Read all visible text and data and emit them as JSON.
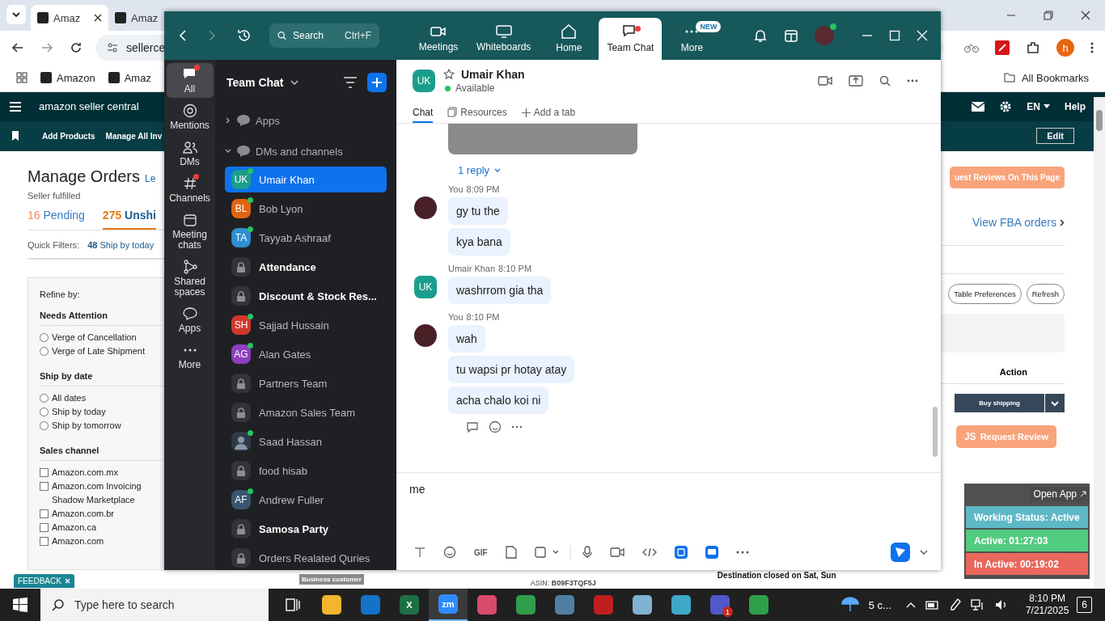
{
  "browser": {
    "tabs": [
      {
        "title": "Amaz",
        "selected": true
      },
      {
        "title": "Amaz",
        "selected": false
      }
    ],
    "address": "sellerce",
    "bookmarks": [
      "Amazon",
      "Amaz"
    ],
    "all_bookmarks": "All Bookmarks",
    "profile_initial": "h"
  },
  "seller": {
    "logo": "amazon seller central",
    "language": "EN",
    "help": "Help",
    "nav": [
      "Add Products",
      "Manage All Inv"
    ],
    "edit": "Edit",
    "title": "Manage Orders",
    "title_link": "Le",
    "subtitle": "Seller fulfilled",
    "order_tabs": [
      {
        "count": "16",
        "label": "Pending",
        "selected": false
      },
      {
        "count": "275",
        "label": "Unshi",
        "selected": true
      }
    ],
    "quick_filters_label": "Quick Filters:",
    "quick_filter": {
      "count": "48",
      "label": "Ship by today"
    },
    "refine_label": "Refine by:",
    "filter_groups": [
      {
        "title": "Needs Attention",
        "kind": "radio",
        "options": [
          {
            "label": "Verge of Cancellation",
            "checked": false
          },
          {
            "label": "Verge of Late Shipment",
            "checked": false
          }
        ]
      },
      {
        "title": "Ship by date",
        "kind": "radio",
        "options": [
          {
            "label": "All dates",
            "checked": false
          },
          {
            "label": "Ship by today",
            "checked": false
          },
          {
            "label": "Ship by tomorrow",
            "checked": false
          }
        ]
      },
      {
        "title": "Sales channel",
        "kind": "checkbox",
        "options": [
          {
            "label": "Amazon.com.mx",
            "checked": false
          },
          {
            "label": "Amazon.com Invoicing Shadow Marketplace",
            "checked": false
          },
          {
            "label": "Amazon.com.br",
            "checked": false
          },
          {
            "label": "Amazon.ca",
            "checked": false
          },
          {
            "label": "Amazon.com",
            "checked": false
          }
        ]
      }
    ],
    "request_reviews_button": "uest Reviews On This Page",
    "fba_link": "View FBA orders",
    "table_preferences": "Table Preferences",
    "refresh": "Refresh",
    "action_header": "Action",
    "buy_shipping": "Buy shipping",
    "js_badge": "JS",
    "request_review": "Request Review",
    "business_badge": "Business customer",
    "asin": {
      "label": "ASIN:",
      "value": "B09F3TQF5J"
    },
    "destination": "Destination closed on Sat, Sun",
    "feedback": "FEEDBACK"
  },
  "zoom": {
    "search": {
      "placeholder": "Search",
      "shortcut": "Ctrl+F"
    },
    "nav": [
      {
        "label": "Meetings",
        "selected": false,
        "dot": false
      },
      {
        "label": "Whiteboards",
        "selected": false,
        "dot": false
      },
      {
        "label": "Home",
        "selected": false,
        "dot": false
      },
      {
        "label": "Team Chat",
        "selected": true,
        "dot": true
      },
      {
        "label": "More",
        "selected": false,
        "dot": false,
        "badge": "NEW"
      }
    ],
    "rail": [
      {
        "label": "All",
        "selected": true,
        "dot": true
      },
      {
        "label": "Mentions",
        "selected": false,
        "dot": false
      },
      {
        "label": "DMs",
        "selected": false,
        "dot": false
      },
      {
        "label": "Channels",
        "selected": false,
        "dot": true
      },
      {
        "label": "Meeting chats",
        "selected": false,
        "dot": false
      },
      {
        "label": "Shared spaces",
        "selected": false,
        "dot": false
      },
      {
        "label": "Apps",
        "selected": false,
        "dot": false
      },
      {
        "label": "More",
        "selected": false,
        "dot": false
      }
    ],
    "list_title": "Team Chat",
    "sections": [
      {
        "label": "Apps",
        "expanded": false
      },
      {
        "label": "DMs and channels",
        "expanded": true,
        "items": [
          {
            "name": "Umair Khan",
            "kind": "initials",
            "initials": "UK",
            "color": "#1a9e8c",
            "online": true,
            "bold": false,
            "selected": true
          },
          {
            "name": "Bob Lyon",
            "kind": "initials",
            "initials": "BL",
            "color": "#e0640f",
            "online": true,
            "bold": false,
            "selected": false
          },
          {
            "name": "Tayyab Ashraaf",
            "kind": "initials",
            "initials": "TA",
            "color": "#2f8fd0",
            "online": true,
            "bold": false,
            "selected": false
          },
          {
            "name": "Attendance",
            "kind": "lock",
            "online": false,
            "bold": true,
            "selected": false
          },
          {
            "name": "Discount & Stock Res...",
            "kind": "lock",
            "online": false,
            "bold": true,
            "selected": false
          },
          {
            "name": "Sajjad Hussain",
            "kind": "initials",
            "initials": "SH",
            "color": "#d2372c",
            "online": true,
            "bold": false,
            "selected": false
          },
          {
            "name": "Alan Gates",
            "kind": "initials",
            "initials": "AG",
            "color": "#8e3fc0",
            "online": true,
            "bold": false,
            "selected": false
          },
          {
            "name": "Partners Team",
            "kind": "lock",
            "online": false,
            "bold": false,
            "selected": false
          },
          {
            "name": "Amazon Sales Team",
            "kind": "lock",
            "online": false,
            "bold": false,
            "selected": false
          },
          {
            "name": "Saad Hassan",
            "kind": "photo",
            "online": true,
            "bold": false,
            "selected": false
          },
          {
            "name": "food hisab",
            "kind": "lock",
            "online": false,
            "bold": false,
            "selected": false
          },
          {
            "name": "Andrew Fuller",
            "kind": "initials",
            "initials": "AF",
            "color": "#3a5570",
            "online": true,
            "bold": false,
            "selected": false
          },
          {
            "name": "Samosa Party",
            "kind": "lock",
            "online": false,
            "bold": true,
            "selected": false
          },
          {
            "name": "Orders Realated Quries",
            "kind": "lock",
            "online": false,
            "bold": false,
            "selected": false
          }
        ]
      }
    ],
    "chat": {
      "contact": {
        "initials": "UK",
        "name": "Umair Khan",
        "status": "Available"
      },
      "tabs": [
        {
          "label": "Chat",
          "selected": true
        },
        {
          "label": "Resources",
          "selected": false
        }
      ],
      "add_tab": "Add a tab",
      "reply_link": "1 reply",
      "groups": [
        {
          "kind": "self",
          "sender": "You",
          "time": "8:09 PM",
          "messages": [
            "gy tu the",
            "kya bana"
          ]
        },
        {
          "kind": "contact",
          "initials": "UK",
          "sender": "Umair Khan",
          "time": "8:10 PM",
          "messages": [
            "washrrom gia tha"
          ]
        },
        {
          "kind": "self",
          "sender": "You",
          "time": "8:10 PM",
          "messages": [
            "wah",
            "tu wapsi pr hotay atay",
            "acha chalo koi ni"
          ]
        }
      ],
      "composer": {
        "value": "me",
        "gif": "GIF"
      }
    }
  },
  "tracker": {
    "open_app": "Open App",
    "rows": [
      {
        "label": "Working Status: Active",
        "color": "#5fb8c6"
      },
      {
        "label": "Active: 01:27:03",
        "color": "#52cc7f"
      },
      {
        "label": "In Active: 00:19:02",
        "color": "#e9675d"
      }
    ]
  },
  "taskbar": {
    "search_placeholder": "Type here to search",
    "apps": [
      {
        "kind": "taskview",
        "selected": false
      },
      {
        "kind": "folder",
        "selected": false
      },
      {
        "kind": "outlook",
        "selected": false
      },
      {
        "kind": "excel",
        "label": "X",
        "selected": false
      },
      {
        "kind": "zoom",
        "label": "zm",
        "selected": true
      },
      {
        "kind": "snip",
        "selected": false
      },
      {
        "kind": "chrome",
        "selected": false
      },
      {
        "kind": "calculator",
        "selected": false
      },
      {
        "kind": "filezilla",
        "selected": false
      },
      {
        "kind": "notes",
        "selected": false
      },
      {
        "kind": "cube",
        "selected": false
      },
      {
        "kind": "teams",
        "badge": "1",
        "selected": false
      },
      {
        "kind": "chrome",
        "selected": false
      }
    ],
    "weather": "5 c...",
    "time": "8:10 PM",
    "date": "7/21/2025",
    "notifications": "6"
  }
}
